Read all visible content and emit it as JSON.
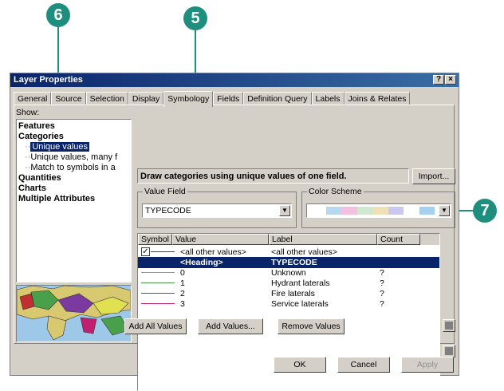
{
  "callouts": [
    "6",
    "5",
    "7"
  ],
  "window": {
    "title": "Layer Properties",
    "help_btn": "?",
    "close_btn": "×"
  },
  "tabs": [
    "General",
    "Source",
    "Selection",
    "Display",
    "Symbology",
    "Fields",
    "Definition Query",
    "Labels",
    "Joins & Relates"
  ],
  "active_tab": "Symbology",
  "show": {
    "label": "Show:",
    "tree": [
      {
        "text": "Features",
        "bold": true,
        "indent": 0
      },
      {
        "text": "Categories",
        "bold": true,
        "indent": 0
      },
      {
        "text": "Unique values",
        "bold": false,
        "indent": 1,
        "selected": true
      },
      {
        "text": "Unique values, many f",
        "bold": false,
        "indent": 1
      },
      {
        "text": "Match to symbols in a",
        "bold": false,
        "indent": 1
      },
      {
        "text": "Quantities",
        "bold": true,
        "indent": 0
      },
      {
        "text": "Charts",
        "bold": true,
        "indent": 0
      },
      {
        "text": "Multiple Attributes",
        "bold": true,
        "indent": 0
      }
    ]
  },
  "description": "Draw categories using unique values of one field.",
  "import_label": "Import...",
  "value_field": {
    "label": "Value Field",
    "value": "TYPECODE"
  },
  "color_scheme": {
    "label": "Color Scheme"
  },
  "table": {
    "columns": [
      "Symbol",
      "Value",
      "Label",
      "Count"
    ],
    "rows": [
      {
        "value": "<all other values>",
        "label": "<all other values>",
        "count": "",
        "color": "#2040a0",
        "checkbox": true
      },
      {
        "value": "<Heading>",
        "label": "TYPECODE",
        "count": "",
        "heading": true
      },
      {
        "value": "0",
        "label": "Unknown",
        "count": "?",
        "color": "#9aa648"
      },
      {
        "value": "1",
        "label": "Hydrant laterals",
        "count": "?",
        "color": "#4a9a4a"
      },
      {
        "value": "2",
        "label": "Fire laterals",
        "count": "?",
        "color": "#c03030"
      },
      {
        "value": "3",
        "label": "Service laterals",
        "count": "?",
        "color": "#c02070"
      }
    ]
  },
  "buttons": {
    "add_all": "Add All Values",
    "add_values": "Add Values...",
    "remove_values": "Remove Values",
    "ok": "OK",
    "cancel": "Cancel",
    "apply": "Apply"
  },
  "colors": {
    "accent": "#1e8e7e",
    "selection": "#0a246a",
    "titlebar": "#0a246a"
  }
}
